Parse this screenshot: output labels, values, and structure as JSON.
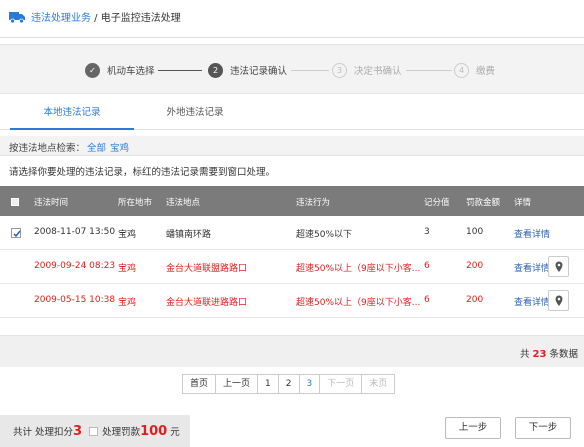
{
  "header": {
    "section": "违法处理业务",
    "separator": " / ",
    "page": "电子监控违法处理"
  },
  "steps": [
    {
      "num": "✓",
      "label": "机动车选择"
    },
    {
      "num": "2",
      "label": "违法记录确认"
    },
    {
      "num": "3",
      "label": "决定书确认"
    },
    {
      "num": "4",
      "label": "缴费"
    }
  ],
  "tabs": {
    "local": "本地违法记录",
    "remote": "外地违法记录"
  },
  "search": {
    "label": "按违法地点检索：",
    "opt_all": "全部",
    "opt_city": "宝鸡"
  },
  "notice": "请选择你要处理的违法记录，标红的违法记录需要到窗口处理。",
  "table": {
    "headers": [
      "违法时间",
      "所在地市",
      "违法地点",
      "违法行为",
      "记分值",
      "罚款金额",
      "详情"
    ],
    "rows": [
      {
        "time": "2008-11-07 13:50",
        "city": "宝鸡",
        "place": "蟠镇南环路",
        "act": "超速50%以下",
        "score": "3",
        "fine": "100",
        "detail": "查看详情"
      },
      {
        "time": "2009-09-24 08:23",
        "city": "宝鸡",
        "place": "金台大道联盟路路口",
        "act": "超速50%以上（9座以下小客...",
        "score": "6",
        "fine": "200",
        "detail": "查看详情"
      },
      {
        "time": "2009-05-15 10:38",
        "city": "宝鸡",
        "place": "金台大道联进路路口",
        "act": "超速50%以上（9座以下小客...",
        "score": "6",
        "fine": "200",
        "detail": "查看详情"
      }
    ]
  },
  "total": {
    "prefix": "共 ",
    "count": "23",
    "suffix": " 条数据"
  },
  "pager": {
    "first": "首页",
    "prev": "上一页",
    "p1": "1",
    "p2": "2",
    "p3": "3",
    "next": "下一页",
    "last": "末页"
  },
  "summary": {
    "label1": "共计 处理扣分",
    "points": "3",
    "label2": "处理罚款",
    "amount": "100",
    "unit": "元"
  },
  "buttons": {
    "prev": "上一步",
    "next": "下一步"
  },
  "colors": {
    "accent": "#2b7bd6",
    "alert": "#e02020",
    "table_header": "#7b7b7b"
  }
}
